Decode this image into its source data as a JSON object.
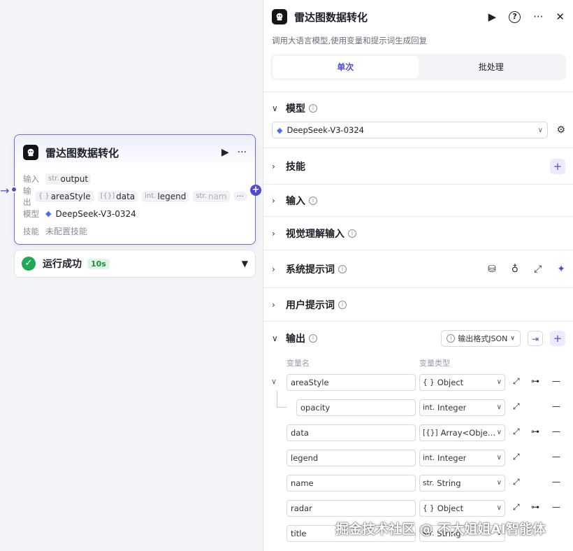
{
  "node": {
    "title": "雷达图数据转化",
    "run_icon": "▶",
    "more_icon": "···",
    "input_label": "输入",
    "input_type": "str.",
    "input_value": "output",
    "output_label": "输出",
    "outputs": [
      {
        "type": "{ }",
        "name": "areaStyle"
      },
      {
        "type": "[{}]",
        "name": "data"
      },
      {
        "type": "int.",
        "name": "legend"
      },
      {
        "type": "str.",
        "name": "nam"
      }
    ],
    "more_outputs": "···",
    "model_label": "模型",
    "model_value": "DeepSeek-V3-0324",
    "skill_label": "技能",
    "skill_value": "未配置技能"
  },
  "run": {
    "status": "运行成功",
    "time": "10s"
  },
  "panel": {
    "title": "雷达图数据转化",
    "description": "调用大语言模型,使用变量和提示词生成回复",
    "tabs": [
      {
        "label": "单次",
        "active": true
      },
      {
        "label": "批处理",
        "active": false
      }
    ],
    "sections": {
      "model": "模型",
      "skills": "技能",
      "input": "输入",
      "visual": "视觉理解输入",
      "system_prompt": "系统提示词",
      "user_prompt": "用户提示词",
      "output": "输出"
    },
    "model_selected": "DeepSeek-V3-0324",
    "output_format": "输出格式JSON",
    "col_name": "变量名",
    "col_type": "变量类型",
    "variables": [
      {
        "name": "areaStyle",
        "type_tag": "{ }",
        "type": "Object"
      },
      {
        "name": "opacity",
        "type_tag": "int.",
        "type": "Integer"
      },
      {
        "name": "data",
        "type_tag": "[{}]",
        "type": "Array<Object>"
      },
      {
        "name": "legend",
        "type_tag": "int.",
        "type": "Integer"
      },
      {
        "name": "name",
        "type_tag": "str.",
        "type": "String"
      },
      {
        "name": "radar",
        "type_tag": "{ }",
        "type": "Object"
      },
      {
        "name": "title",
        "type_tag": "str.",
        "type": "String"
      }
    ]
  },
  "watermark": "掘金技术社区 @ 不大姐姐AI智能体"
}
